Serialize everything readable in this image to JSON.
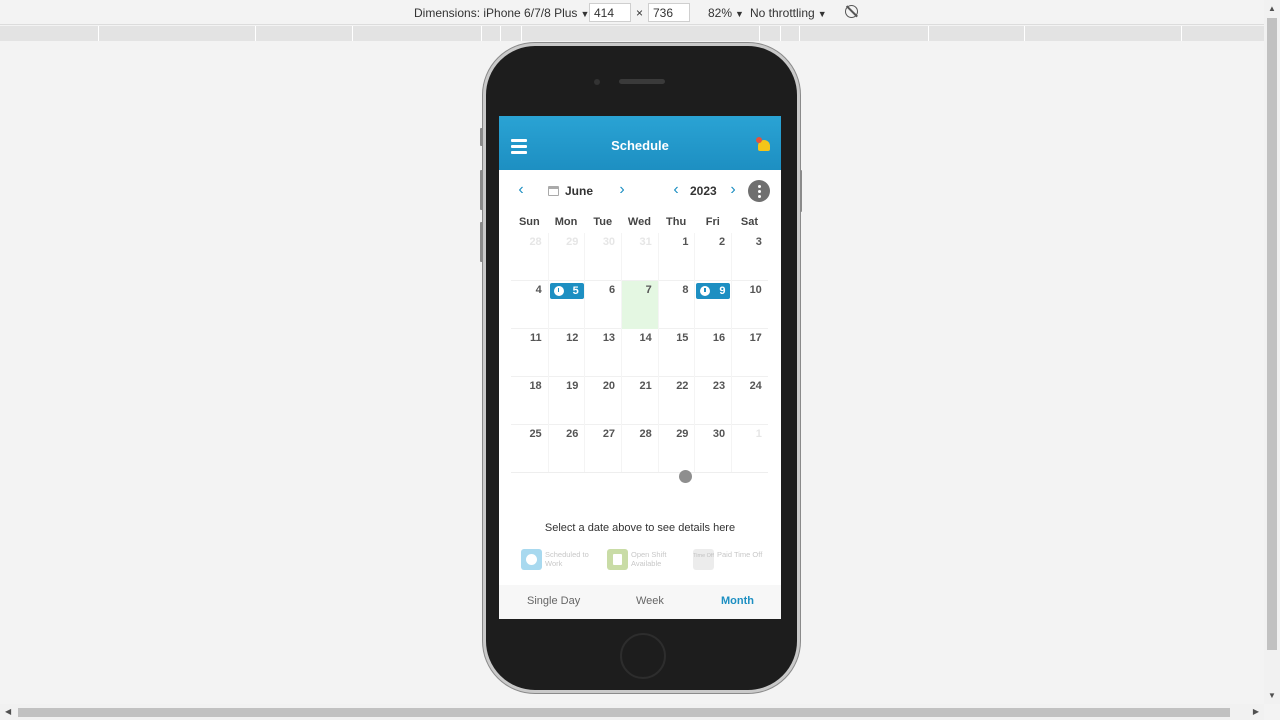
{
  "devtools": {
    "dimensions_label": "Dimensions: iPhone 6/7/8 Plus",
    "width_value": "414",
    "times": "×",
    "height_value": "736",
    "zoom": "82%",
    "throttling": "No throttling",
    "dropdown_glyph": "▼",
    "icons": [
      "rotate-icon"
    ]
  },
  "app": {
    "title": "Schedule",
    "accent_color": "#1d8fc2",
    "today_color": "#e4f7e2",
    "icons": [
      "hamburger-menu-icon",
      "notification-bell-icon",
      "calendar-icon",
      "more-options-icon"
    ]
  },
  "navigation": {
    "prev_glyph": "‹",
    "next_glyph": "›",
    "month": "June",
    "year": "2023"
  },
  "weekdays": [
    "Sun",
    "Mon",
    "Tue",
    "Wed",
    "Thu",
    "Fri",
    "Sat"
  ],
  "calendar": {
    "weeks": [
      [
        "28",
        "29",
        "30",
        "31",
        "1",
        "2",
        "3"
      ],
      [
        "4",
        "5",
        "6",
        "7",
        "8",
        "9",
        "10"
      ],
      [
        "11",
        "12",
        "13",
        "14",
        "15",
        "16",
        "17"
      ],
      [
        "18",
        "19",
        "20",
        "21",
        "22",
        "23",
        "24"
      ],
      [
        "25",
        "26",
        "27",
        "28",
        "29",
        "30",
        "1"
      ]
    ],
    "scheduled_days": [
      "5",
      "9"
    ],
    "today": "7"
  },
  "details_hint": "Select a date above to see details here",
  "legend": {
    "scheduled": "Scheduled to Work",
    "open_shift": "Open Shift Available",
    "paid_time_off": "Paid Time Off",
    "paid_icon_text": "Time Off"
  },
  "tabs": {
    "single_day": "Single Day",
    "week": "Week",
    "month": "Month",
    "active": "Month"
  }
}
